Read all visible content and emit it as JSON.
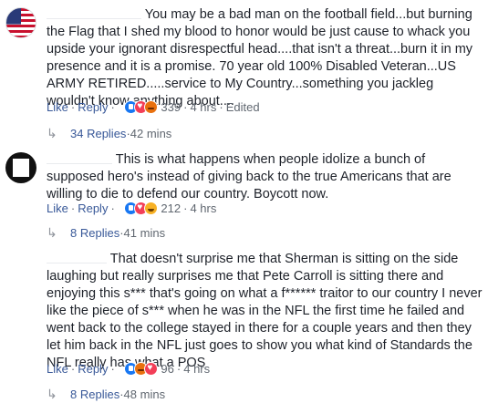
{
  "comments": [
    {
      "avatar": "us-flag-avatar",
      "text": "You may be a bad man on the football field...but burning the Flag that I shed my blood to honor would be just cause to whack you upside your ignorant disrespectful head....that isn't a threat...burn it in my presence and it is a promise. 70 year old 100% Disabled Veteran...US ARMY RETIRED.....service to My Country...something you jackleg wouldn't know anything about....",
      "like_label": "Like",
      "reply_label": "Reply",
      "reaction_count": "339",
      "time": "4 hrs",
      "edited": "Edited",
      "replies_label": "34 Replies",
      "replies_time": "42 mins"
    },
    {
      "avatar": "black-frame-avatar",
      "text": "This is what happens when people idolize a bunch of supposed hero's instead of giving back to the true Americans that are willing to die to defend our country. Boycott now.",
      "like_label": "Like",
      "reply_label": "Reply",
      "reaction_count": "212",
      "time": "4 hrs",
      "replies_label": "8 Replies",
      "replies_time": "41 mins"
    },
    {
      "avatar": "none",
      "text": "That doesn't surprise me that Sherman is sitting on the side laughing but really surprises me that Pete Carroll is sitting there and enjoying this s*** that's going on what a f****** traitor to our country I never like the piece of s*** when he was in the NFL the first time he failed and went back to the college stayed in there for a couple years and then they let him back in the NFL just goes to show you what kind of Standards the NFL really has what a POS",
      "like_label": "Like",
      "reply_label": "Reply",
      "reaction_count": "96",
      "time": "4 hrs",
      "replies_label": "8 Replies",
      "replies_time": "48 mins"
    }
  ],
  "separators": {
    "dot": "·"
  },
  "icons": {
    "reply_arrow": "reply-arrow-icon"
  },
  "colors": {
    "link": "#385898",
    "meta": "#606770",
    "text": "#1d2129",
    "like_reaction": "#1877f2",
    "love_reaction": "#f33e58",
    "angry_reaction": "#e9710f",
    "haha_reaction": "#f7b125"
  }
}
